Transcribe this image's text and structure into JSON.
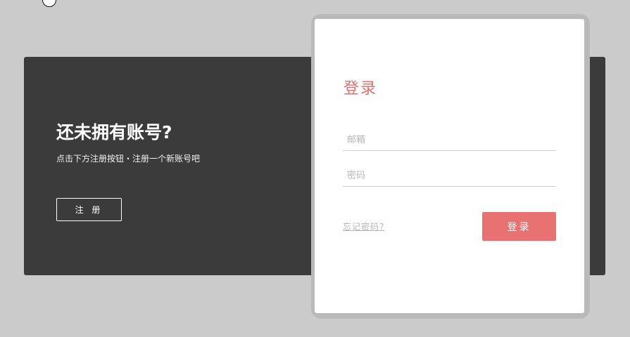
{
  "welcome": {
    "title": "还未拥有账号?",
    "subtitle": "点击下方注册按钮・注册一个新账号吧",
    "register_label": "注 册"
  },
  "login": {
    "title": "登录",
    "email_placeholder": "邮箱",
    "password_placeholder": "密码",
    "forgot_label": "忘记密码?",
    "submit_label": "登录"
  },
  "colors": {
    "background": "#cbcbcb",
    "dark_panel": "#3b3b3b",
    "accent": "#e87272",
    "accent_text": "#e07070"
  }
}
